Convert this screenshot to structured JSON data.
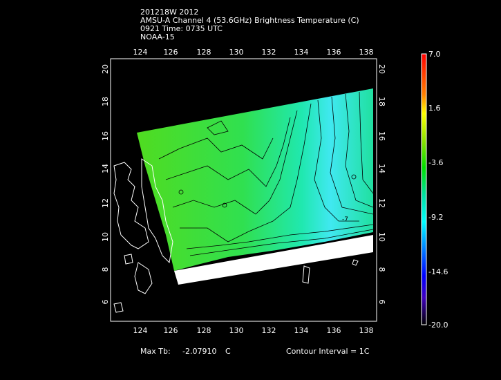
{
  "header": {
    "line1": "201218W 2012",
    "line2": "AMSU-A Channel 4 (53.6GHz) Brightness Temperature (C)",
    "line3": "0921 Time: 0735 UTC",
    "line4": "NOAA-15"
  },
  "map": {
    "lon_ticks": [
      "124",
      "126",
      "128",
      "130",
      "132",
      "134",
      "136",
      "138"
    ],
    "lat_ticks": [
      "20",
      "18",
      "16",
      "14",
      "12",
      "10",
      "8",
      "6"
    ],
    "contour_label": "-7"
  },
  "colorbar": {
    "labels": [
      "7.0",
      "1.6",
      "-3.6",
      "-9.2",
      "-14.6",
      "-20.0"
    ],
    "max": 7.0,
    "min": -20.0,
    "colors": [
      "#ff0000",
      "#ff8000",
      "#ffff00",
      "#80e000",
      "#00e000",
      "#00e0a0",
      "#00ffff",
      "#0080ff",
      "#0000ff",
      "#4000c0",
      "#300060",
      "#000000"
    ]
  },
  "footer": {
    "max_tb_label": "Max Tb:",
    "max_tb_value": "-2.07910",
    "max_tb_unit": "C",
    "contour_interval": "Contour Interval = 1C"
  }
}
